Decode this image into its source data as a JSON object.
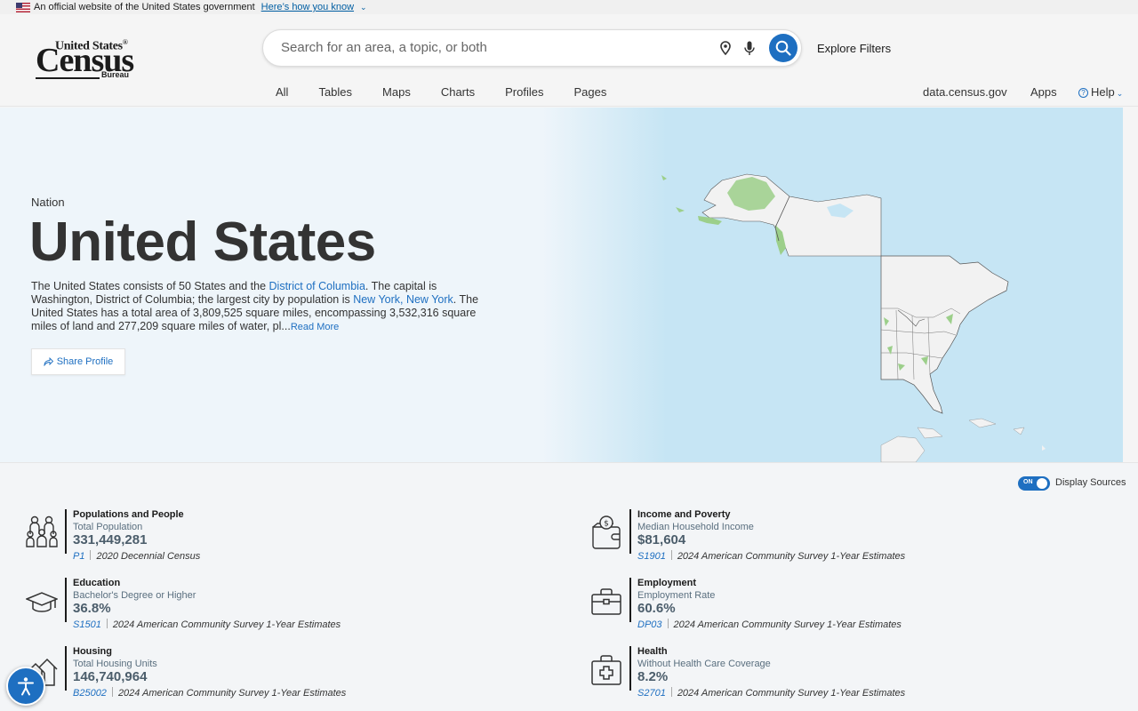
{
  "gov_banner": {
    "text": "An official website of the United States government",
    "how_link": "Here’s how you know"
  },
  "logo": {
    "line1": "United States",
    "line2": "Census",
    "line3": "Bureau"
  },
  "search": {
    "placeholder": "Search for an area, a topic, or both"
  },
  "explore_filters": "Explore Filters",
  "tabs": [
    "All",
    "Tables",
    "Maps",
    "Charts",
    "Profiles",
    "Pages"
  ],
  "utility_nav": {
    "data_link": "data.census.gov",
    "apps": "Apps",
    "help": "Help"
  },
  "hero": {
    "level": "Nation",
    "title": "United States",
    "desc": {
      "p1": "The United States consists of 50 States and the ",
      "link1": "District of Columbia",
      "p2": ". The capital is Washington, District of Columbia; the largest city by population is ",
      "link2": "New York, New York",
      "p3": ". The United States has a total area of 3,809,525 square miles, encompassing 3,532,316 square miles of land and 277,209 square miles of water, pl...",
      "read_more": "Read More"
    },
    "share": "Share Profile"
  },
  "display_sources": {
    "toggle_text": "ON",
    "label": "Display Sources"
  },
  "stats": [
    {
      "icon": "people-icon",
      "category": "Populations and People",
      "label": "Total Population",
      "value": "331,449,281",
      "code": "P1",
      "source": "2020 Decennial Census"
    },
    {
      "icon": "income-bag-icon",
      "category": "Income and Poverty",
      "label": "Median Household Income",
      "value": "$81,604",
      "code": "S1901",
      "source": "2024 American Community Survey 1-Year Estimates"
    },
    {
      "icon": "graduation-cap-icon",
      "category": "Education",
      "label": "Bachelor's Degree or Higher",
      "value": "36.8%",
      "code": "S1501",
      "source": "2024 American Community Survey 1-Year Estimates"
    },
    {
      "icon": "briefcase-icon",
      "category": "Employment",
      "label": "Employment Rate",
      "value": "60.6%",
      "code": "DP03",
      "source": "2024 American Community Survey 1-Year Estimates"
    },
    {
      "icon": "houses-icon",
      "category": "Housing",
      "label": "Total Housing Units",
      "value": "146,740,964",
      "code": "B25002",
      "source": "2024 American Community Survey 1-Year Estimates"
    },
    {
      "icon": "medical-kit-icon",
      "category": "Health",
      "label": "Without Health Care Coverage",
      "value": "8.2%",
      "code": "S2701",
      "source": "2024 American Community Survey 1-Year Estimates"
    }
  ],
  "colors": {
    "accent": "#1e6fc1",
    "hero_bg": "#eef5fa",
    "map_water": "#c6e5f4",
    "map_land": "#f2f2f2",
    "map_highlight": "#9ccf8a"
  }
}
